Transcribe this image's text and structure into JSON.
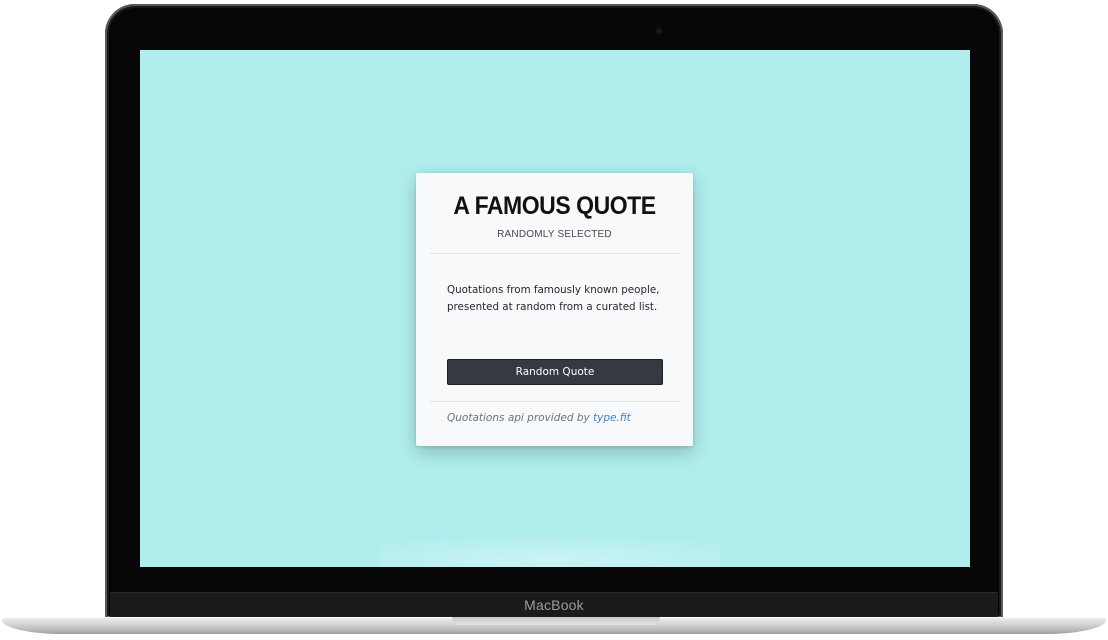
{
  "device": {
    "brand_label": "MacBook"
  },
  "page": {
    "background_color": "#b0eded"
  },
  "card": {
    "title": "A FAMOUS QUOTE",
    "subtitle": "RANDOMLY SELECTED",
    "description_line1": "Quotations from famously known people,",
    "description_line2": "presented at random from a curated list.",
    "button_label": "Random Quote",
    "footer_text": "Quotations api provided by ",
    "footer_link_text": "type.fit",
    "link_color": "#3f7fd0",
    "button_color": "#353a42"
  }
}
